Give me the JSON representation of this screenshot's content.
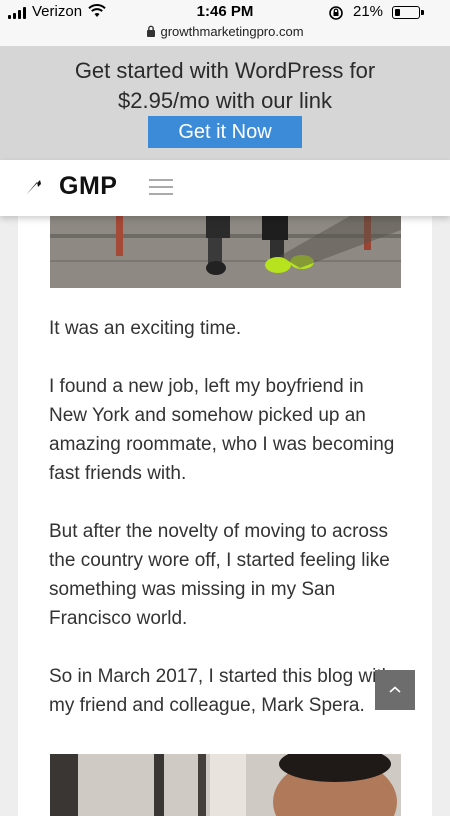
{
  "status_bar": {
    "carrier": "Verizon",
    "time": "1:46 PM",
    "battery_percent": "21%",
    "url": "growthmarketingpro.com",
    "icons": [
      "signal-bars-icon",
      "wifi-icon",
      "rotation-lock-icon",
      "battery-icon",
      "padlock-icon"
    ]
  },
  "promo": {
    "text": "Get started with WordPress for $2.95/mo with our link",
    "button_label": "Get it Now",
    "button_color": "#3c8bd9",
    "background": "#d6d6d6"
  },
  "navbar": {
    "logo_text": "GMP",
    "logo_icon": "lightning-bolt-icon",
    "menu_icon": "hamburger-menu-icon"
  },
  "article": {
    "paragraphs": [
      "It was an exciting time.",
      "I found a new job, left my boyfriend in New York and somehow picked up an amazing roommate, who I was becoming fast friends with.",
      "But after the novelty of moving to across the country wore off, I started feeling like something was missing in my San Francisco world.",
      "So in March 2017, I started this blog with my friend and colleague, Mark Spera."
    ]
  },
  "back_to_top": {
    "icon": "chevron-up-icon"
  }
}
